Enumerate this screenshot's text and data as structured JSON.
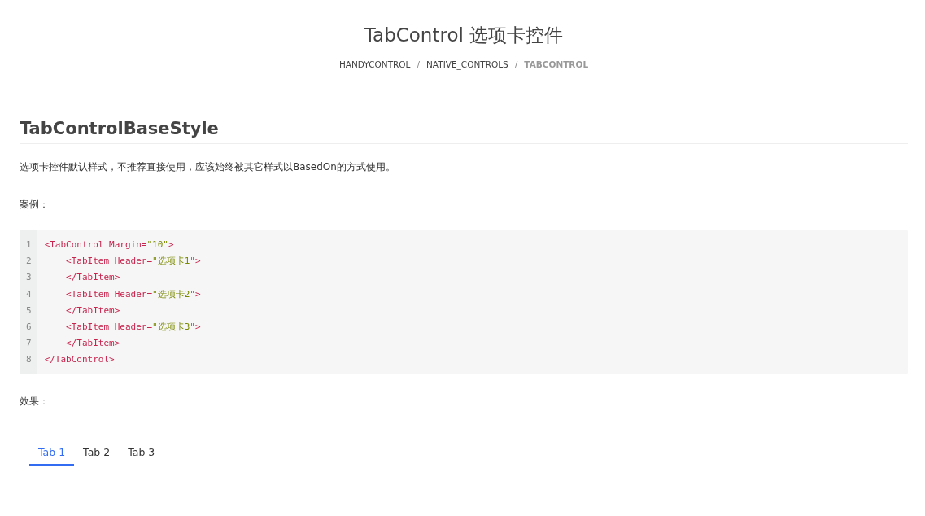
{
  "page_title": "TabControl 选项卡控件",
  "breadcrumb": [
    {
      "label": "HANDYCONTROL",
      "current": false
    },
    {
      "label": "NATIVE_CONTROLS",
      "current": false
    },
    {
      "label": "TABCONTROL",
      "current": true
    }
  ],
  "breadcrumb_separator": "/",
  "section_heading": "TabControlBaseStyle",
  "description": "选项卡控件默认样式，不推荐直接使用，应该始终被其它样式以BasedOn的方式使用。",
  "example_label": "案例：",
  "code_lines": [
    {
      "number": "1",
      "tokens": [
        {
          "kind": "tag",
          "text": "<TabControl Margin="
        },
        {
          "kind": "value",
          "text": "\"10\""
        },
        {
          "kind": "tag",
          "text": ">"
        }
      ]
    },
    {
      "number": "2",
      "tokens": [
        {
          "kind": "tag",
          "text": "    <TabItem Header="
        },
        {
          "kind": "value",
          "text": "\"选项卡1\""
        },
        {
          "kind": "tag",
          "text": ">"
        }
      ]
    },
    {
      "number": "3",
      "tokens": [
        {
          "kind": "tag",
          "text": "    </TabItem>"
        }
      ]
    },
    {
      "number": "4",
      "tokens": [
        {
          "kind": "tag",
          "text": "    <TabItem Header="
        },
        {
          "kind": "value",
          "text": "\"选项卡2\""
        },
        {
          "kind": "tag",
          "text": ">"
        }
      ]
    },
    {
      "number": "5",
      "tokens": [
        {
          "kind": "tag",
          "text": "    </TabItem>"
        }
      ]
    },
    {
      "number": "6",
      "tokens": [
        {
          "kind": "tag",
          "text": "    <TabItem Header="
        },
        {
          "kind": "value",
          "text": "\"选项卡3\""
        },
        {
          "kind": "tag",
          "text": ">"
        }
      ]
    },
    {
      "number": "7",
      "tokens": [
        {
          "kind": "tag",
          "text": "    </TabItem>"
        }
      ]
    },
    {
      "number": "8",
      "tokens": [
        {
          "kind": "tag",
          "text": "</TabControl>"
        }
      ]
    }
  ],
  "result_label": "效果：",
  "tabs": [
    {
      "label": "Tab 1",
      "selected": true
    },
    {
      "label": "Tab 2",
      "selected": false
    },
    {
      "label": "Tab 3",
      "selected": false
    }
  ]
}
